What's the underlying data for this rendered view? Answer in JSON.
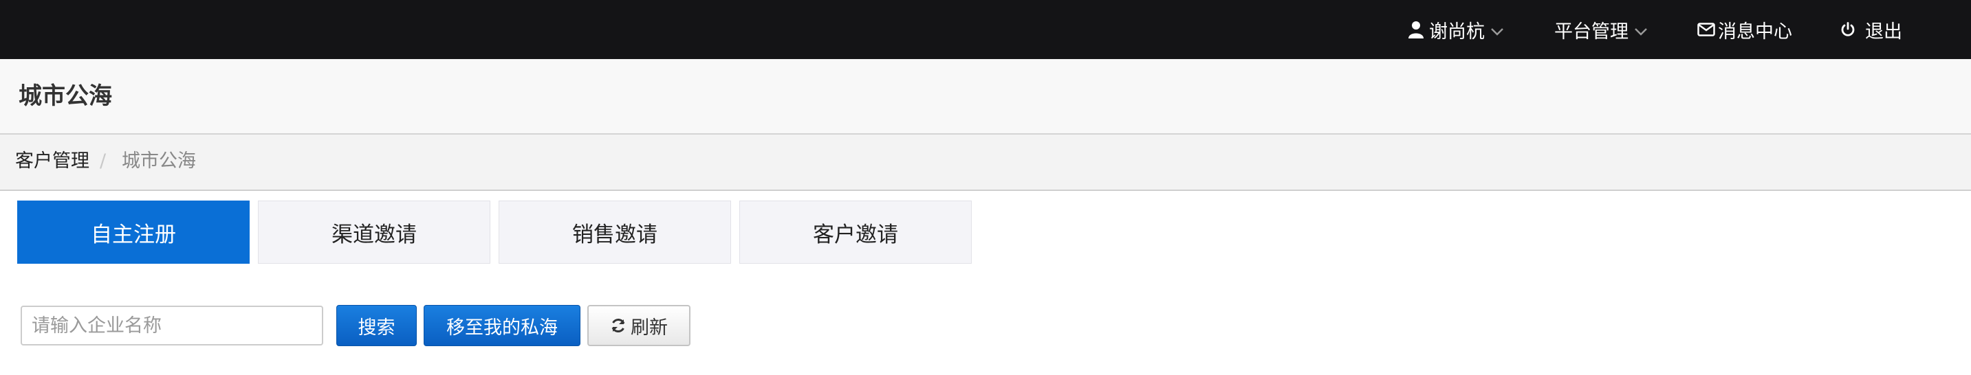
{
  "navbar": {
    "user": {
      "label": "谢尚杭",
      "icon": "user-icon"
    },
    "platform": {
      "label": "平台管理",
      "icon": "chevron-down-icon"
    },
    "messages": {
      "label": "消息中心",
      "icon": "envelope-icon"
    },
    "logout": {
      "label": "退出",
      "icon": "power-icon"
    }
  },
  "page": {
    "title": "城市公海"
  },
  "breadcrumb": {
    "items": [
      "客户管理",
      "城市公海"
    ],
    "separator": "/"
  },
  "tabs": [
    {
      "label": "自主注册",
      "active": true
    },
    {
      "label": "渠道邀请",
      "active": false
    },
    {
      "label": "销售邀请",
      "active": false
    },
    {
      "label": "客户邀请",
      "active": false
    }
  ],
  "toolbar": {
    "search_value": "",
    "search_placeholder": "请输入企业名称",
    "search_label": "搜索",
    "move_label": "移至我的私海",
    "refresh_label": "刷新",
    "refresh_icon": "refresh-icon"
  },
  "colors": {
    "navbar_bg": "#141416",
    "primary": "#0a6fd6",
    "tab_inactive_bg": "#f4f4f8"
  }
}
